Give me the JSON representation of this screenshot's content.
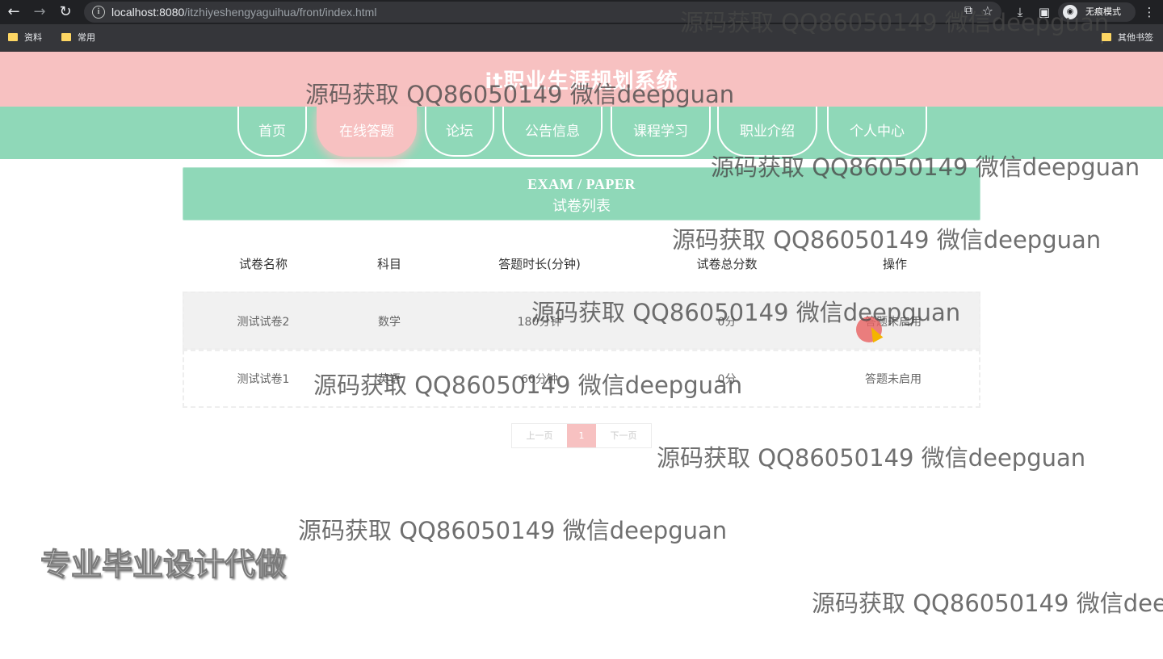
{
  "browser": {
    "url_host": "localhost:8080",
    "url_path": "/itzhiyeshengyaguihua/front/index.html",
    "incognito_label": "无痕模式",
    "bookmarks": [
      "资料",
      "常用"
    ],
    "other_bookmarks": "其他书签"
  },
  "site": {
    "title": "it职业生涯规划系统",
    "nav": [
      "首页",
      "在线答题",
      "论坛",
      "公告信息",
      "课程学习",
      "职业介绍",
      "个人中心"
    ],
    "active_nav": "在线答题"
  },
  "panel": {
    "title_en": "EXAM / PAPER",
    "title_zh": "试卷列表"
  },
  "table": {
    "headers": [
      "试卷名称",
      "科目",
      "答题时长(分钟)",
      "试卷总分数",
      "操作"
    ],
    "rows": [
      [
        "测试试卷2",
        "数学",
        "180分钟",
        "0分",
        "答题未启用"
      ],
      [
        "测试试卷1",
        "英语",
        "60分钟",
        "0分",
        "答题未启用"
      ]
    ]
  },
  "pagination": {
    "prev": "上一页",
    "current": "1",
    "next": "下一页"
  },
  "overlay": {
    "watermark": "源码获取 QQ86050149 微信deepguan",
    "promo": "专业毕业设计代做"
  }
}
